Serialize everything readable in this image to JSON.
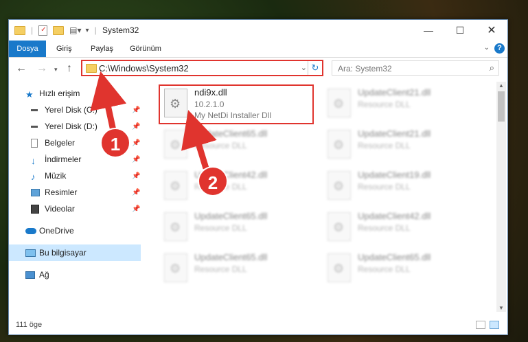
{
  "window": {
    "title": "System32"
  },
  "ribbon": {
    "tabs": [
      {
        "label": "Dosya"
      },
      {
        "label": "Giriş"
      },
      {
        "label": "Paylaş"
      },
      {
        "label": "Görünüm"
      }
    ],
    "help": "?"
  },
  "nav": {
    "address": "C:\\Windows\\System32",
    "search_placeholder": "Ara: System32"
  },
  "sidebar": {
    "items": [
      {
        "label": "Hızlı erişim",
        "icon": "star-icon"
      },
      {
        "label": "Yerel Disk (C:)",
        "icon": "drive-icon",
        "pinned": true
      },
      {
        "label": "Yerel Disk (D:)",
        "icon": "drive-icon",
        "pinned": true
      },
      {
        "label": "Belgeler",
        "icon": "documents-icon",
        "pinned": true
      },
      {
        "label": "İndirmeler",
        "icon": "download-icon",
        "pinned": true
      },
      {
        "label": "Müzik",
        "icon": "music-icon",
        "pinned": true
      },
      {
        "label": "Resimler",
        "icon": "pictures-icon",
        "pinned": true
      },
      {
        "label": "Videolar",
        "icon": "videos-icon",
        "pinned": true
      },
      {
        "label": "OneDrive",
        "icon": "cloud-icon"
      },
      {
        "label": "Bu bilgisayar",
        "icon": "computer-icon",
        "selected": true
      },
      {
        "label": "Ağ",
        "icon": "network-icon"
      }
    ]
  },
  "files": {
    "highlighted": {
      "name": "ndi9x.dll",
      "version": "10.2.1.0",
      "description": "My NetDi Installer Dll"
    },
    "blurred": [
      {
        "name": "UpdateClient21.dll",
        "description": "Resource DLL"
      },
      {
        "name": "UpdateClient65.dll",
        "description": "Resource DLL"
      },
      {
        "name": "UpdateClient21.dll",
        "description": "Resource DLL"
      },
      {
        "name": "UpdateClient42.dll",
        "description": "Resource DLL"
      },
      {
        "name": "UpdateClient19.dll",
        "description": "Resource DLL"
      },
      {
        "name": "UpdateClient65.dll",
        "description": "Resource DLL"
      },
      {
        "name": "UpdateClient42.dll",
        "description": "Resource DLL"
      },
      {
        "name": "UpdateClient65.dll",
        "description": "Resource DLL"
      },
      {
        "name": "UpdateClient65.dll",
        "description": "Resource DLL"
      }
    ]
  },
  "status": {
    "count": "111 öge"
  },
  "annotations": {
    "step1": "1",
    "step2": "2"
  },
  "colors": {
    "accent": "#1979ca",
    "highlight": "#e0342e",
    "selected_bg": "#cce8ff"
  }
}
